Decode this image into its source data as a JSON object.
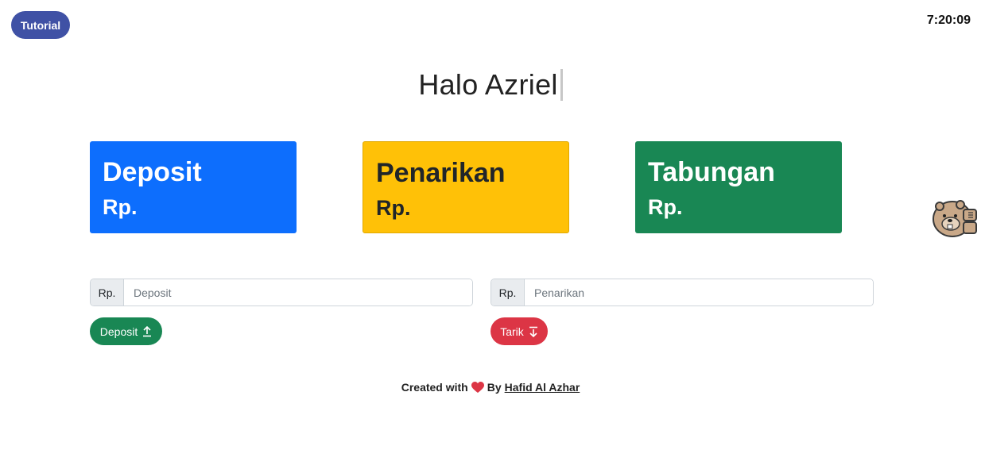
{
  "header": {
    "tutorial_label": "Tutorial",
    "clock": "7:20:09"
  },
  "greeting": {
    "text": "Halo Azriel"
  },
  "cards": {
    "deposit": {
      "title": "Deposit",
      "amount": "Rp.",
      "color": "#0d6efd"
    },
    "penarikan": {
      "title": "Penarikan",
      "amount": "Rp.",
      "color": "#ffc107"
    },
    "tabungan": {
      "title": "Tabungan",
      "amount": "Rp.",
      "color": "#198754"
    }
  },
  "forms": {
    "deposit": {
      "prefix": "Rp.",
      "placeholder": "Deposit",
      "value": "",
      "button_label": "Deposit",
      "button_icon": "upload-arrow-icon",
      "button_color": "#198754"
    },
    "penarikan": {
      "prefix": "Rp.",
      "placeholder": "Penarikan",
      "value": "",
      "button_label": "Tarik",
      "button_icon": "download-arrow-icon",
      "button_color": "#dc3545"
    }
  },
  "footer": {
    "created_with": "Created with",
    "heart_icon": "heart-icon",
    "by": "By",
    "author": "Hafid Al Azhar"
  },
  "mascot": {
    "icon": "beaver-mascot-icon"
  }
}
